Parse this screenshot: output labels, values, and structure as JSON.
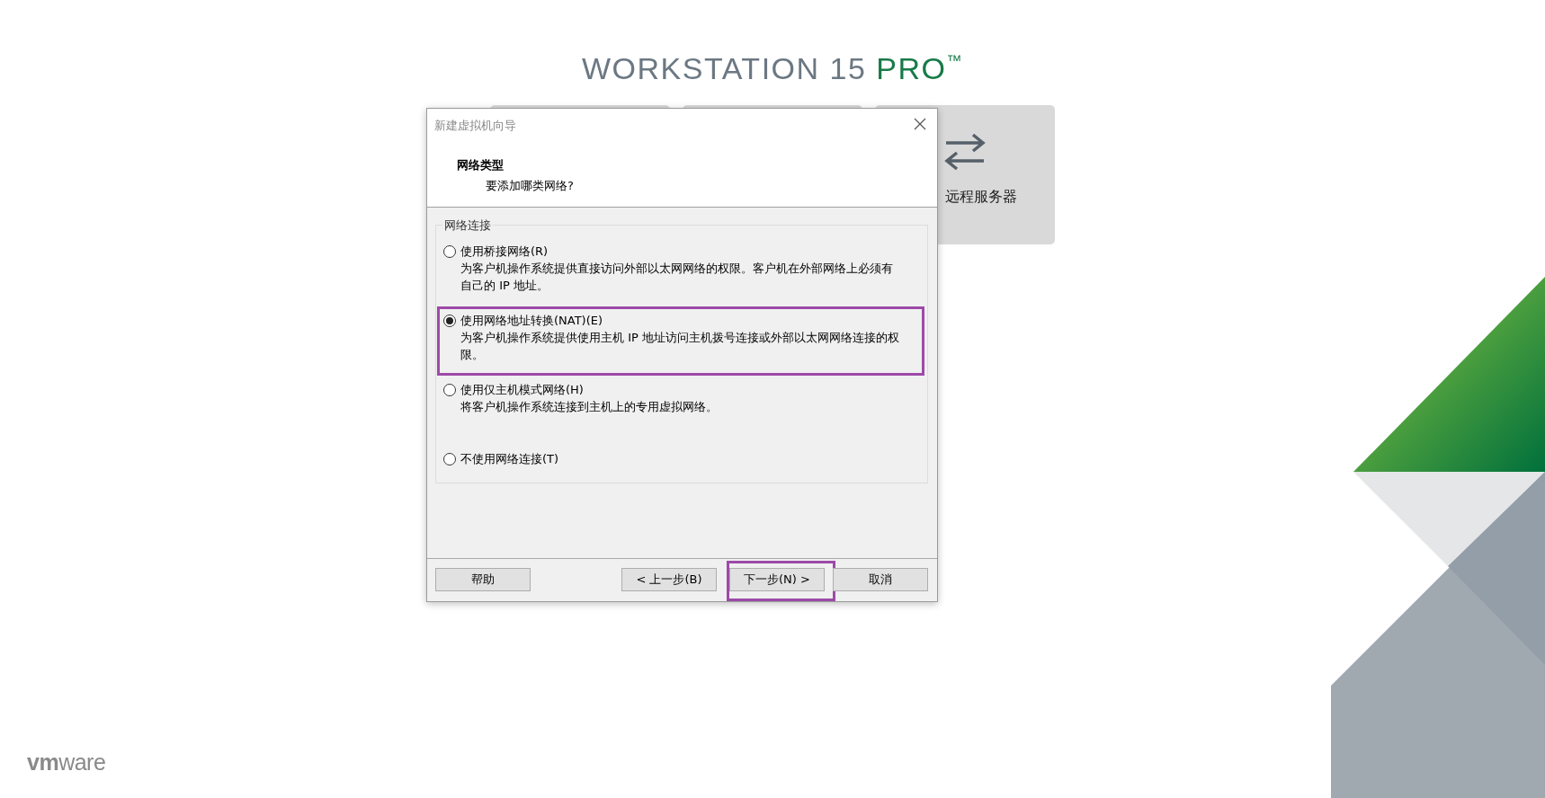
{
  "header": {
    "product": "WORKSTATION 15",
    "edition": "PRO",
    "trademark": "™"
  },
  "start_cards": [
    {
      "kind": "blank"
    },
    {
      "kind": "blank"
    },
    {
      "label": "远程服务器",
      "kind": "remote"
    }
  ],
  "dialog": {
    "title": "新建虚拟机向导",
    "heading": "网络类型",
    "subheading": "要添加哪类网络?",
    "group_label": "网络连接",
    "options": [
      {
        "label": "使用桥接网络(R)",
        "description": "为客户机操作系统提供直接访问外部以太网网络的权限。客户机在外部网络上必须有自己的 IP 地址。",
        "selected": false
      },
      {
        "label": "使用网络地址转换(NAT)(E)",
        "description": "为客户机操作系统提供使用主机 IP 地址访问主机拨号连接或外部以太网网络连接的权限。",
        "selected": true,
        "highlighted": true
      },
      {
        "label": "使用仅主机模式网络(H)",
        "description": "将客户机操作系统连接到主机上的专用虚拟网络。",
        "selected": false
      },
      {
        "label": "不使用网络连接(T)",
        "selected": false
      }
    ],
    "buttons": [
      {
        "label": "帮助",
        "kind": "help"
      },
      {
        "label": "< 上一步(B)",
        "kind": "nav"
      },
      {
        "label": "下一步(N) >",
        "kind": "nav",
        "highlighted": true
      },
      {
        "label": "取消",
        "kind": "nav"
      }
    ]
  },
  "logo": "**vm**ware"
}
